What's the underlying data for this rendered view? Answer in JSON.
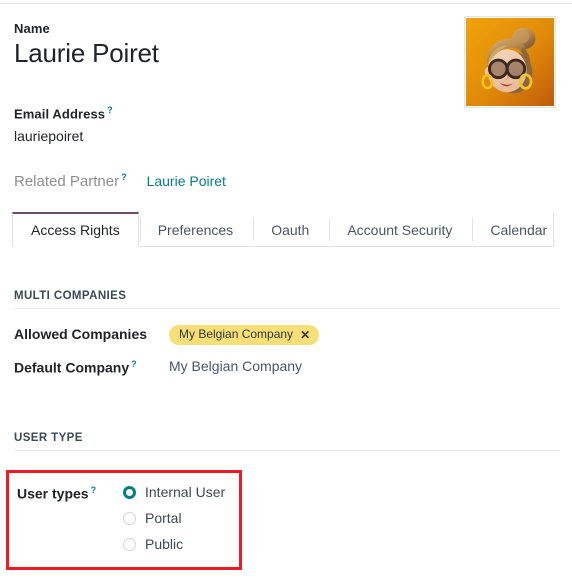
{
  "form": {
    "name": {
      "label": "Name",
      "value": "Laurie Poiret"
    },
    "email": {
      "label": "Email Address",
      "tip": "?",
      "value": "lauriepoiret"
    },
    "related_partner": {
      "label": "Related Partner",
      "tip": "?",
      "value": "Laurie Poiret"
    },
    "avatar": {
      "icon": "user-avatar-image",
      "alt": "Laurie Poiret avatar"
    }
  },
  "tabs": [
    {
      "label": "Access Rights",
      "active": true
    },
    {
      "label": "Preferences",
      "active": false
    },
    {
      "label": "Oauth",
      "active": false
    },
    {
      "label": "Account Security",
      "active": false
    },
    {
      "label": "Calendar",
      "active": false
    }
  ],
  "multi_companies": {
    "title": "MULTI COMPANIES",
    "allowed_companies": {
      "label": "Allowed Companies",
      "tags": [
        {
          "text": "My Belgian Company",
          "remove_icon": "✕"
        }
      ]
    },
    "default_company": {
      "label": "Default Company",
      "tip": "?",
      "value": "My Belgian Company"
    }
  },
  "user_type": {
    "title": "USER TYPE",
    "label": "User types",
    "tip": "?",
    "options": [
      {
        "label": "Internal User",
        "selected": true
      },
      {
        "label": "Portal",
        "selected": false
      },
      {
        "label": "Public",
        "selected": false
      }
    ]
  },
  "colors": {
    "accent_teal": "#017e84",
    "brand_purple": "#714b67",
    "tag_yellow": "#f7df78",
    "highlight_red": "#ec1c24"
  }
}
